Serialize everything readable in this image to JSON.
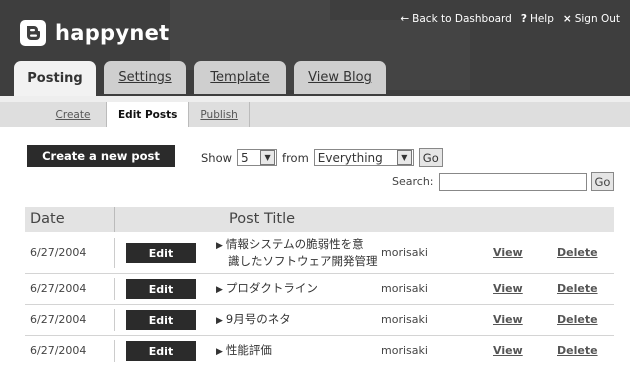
{
  "header": {
    "app_name": "happynet",
    "links": {
      "dashboard": "Back to Dashboard",
      "help": "Help",
      "signout": "Sign Out"
    }
  },
  "tabs": [
    {
      "label": "Posting"
    },
    {
      "label": "Settings"
    },
    {
      "label": "Template"
    },
    {
      "label": "View Blog"
    }
  ],
  "subnav": [
    {
      "label": "Create"
    },
    {
      "label": "Edit Posts"
    },
    {
      "label": "Publish"
    }
  ],
  "toolbar": {
    "create_label": "Create a new post",
    "show_label": "Show",
    "show_value": "5",
    "from_label": "from",
    "from_value": "Everything",
    "go_label": "Go",
    "search_label": "Search:",
    "search_value": "",
    "search_go_label": "Go"
  },
  "table": {
    "headers": {
      "date": "Date",
      "title": "Post Title"
    },
    "rows": [
      {
        "date": "6/27/2004",
        "edit": "Edit",
        "title_line1": "情報システムの脆弱性を意",
        "title_line2": "識したソフトウェア開発管理",
        "author": "morisaki",
        "view": "View",
        "delete": "Delete"
      },
      {
        "date": "6/27/2004",
        "edit": "Edit",
        "title_line1": "プロダクトライン",
        "author": "morisaki",
        "view": "View",
        "delete": "Delete"
      },
      {
        "date": "6/27/2004",
        "edit": "Edit",
        "title_line1": "9月号のネタ",
        "author": "morisaki",
        "view": "View",
        "delete": "Delete"
      },
      {
        "date": "6/27/2004",
        "edit": "Edit",
        "title_line1": "性能評価",
        "author": "morisaki",
        "view": "View",
        "delete": "Delete"
      }
    ]
  }
}
